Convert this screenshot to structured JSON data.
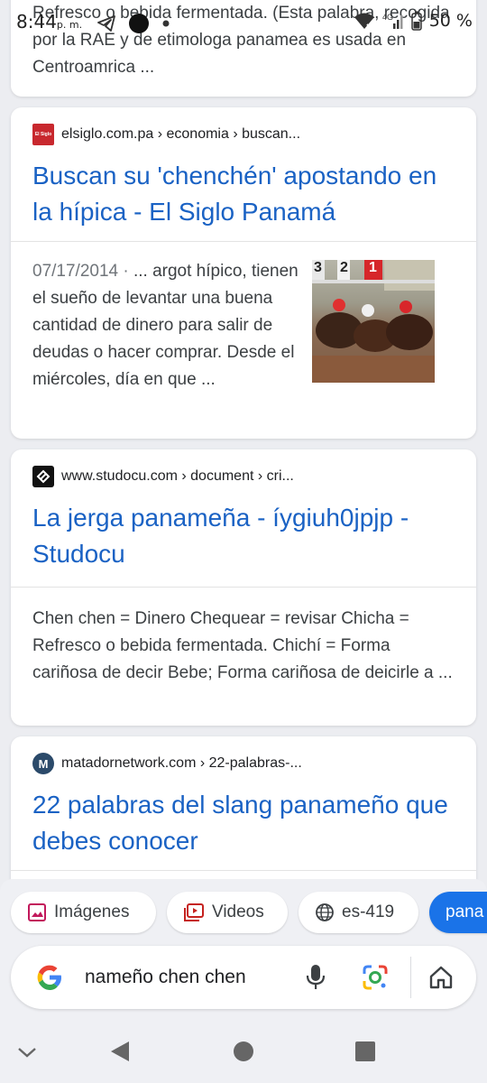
{
  "status_bar": {
    "time": "8:44",
    "ampm": "p. m.",
    "battery": "50 %"
  },
  "results": [
    {
      "snippet": "Refresco o bebida fermentada. (Esta palabra, recogida por la RAE y de etimologa panamea es usada en Centroamrica ..."
    },
    {
      "source": "elsiglo.com.pa › economia › buscan...",
      "favicon_text": "El Siglo",
      "title": "Buscan su 'chenchén' apostando en la hípica - El Siglo Panamá",
      "date": "07/17/2014 · ",
      "snippet": "... argot hípico, tienen el sueño de levantar una buena cantidad de dinero para salir de deudas o hacer comprar. Desde el miércoles, día en que ...",
      "thumbnail": "horse-race-photo",
      "thumbnail_numbers": [
        "3",
        "2",
        "1"
      ]
    },
    {
      "source": "www.studocu.com › document › cri...",
      "title": "La jerga panameña - íygiuh0jpjp - Studocu",
      "snippet": "Chen chen = Dinero Chequear = revisar Chicha = Refresco o bebida fermentada. Chichí = Forma cariñosa de decir Bebe; Forma cariñosa de deicirle a ..."
    },
    {
      "source": "matadornetwork.com › 22-palabras-...",
      "title": "22 palabras del slang panameño que debes conocer"
    }
  ],
  "chips": [
    {
      "label": "Imágenes",
      "icon": "image-icon"
    },
    {
      "label": "Videos",
      "icon": "video-icon"
    },
    {
      "label": "es-419",
      "icon": "globe-icon"
    },
    {
      "label": "pana"
    }
  ],
  "search": {
    "query": "nameño chen chen"
  },
  "colors": {
    "link": "#1a62c4",
    "accent": "#1a73e8",
    "background": "#ecedf1"
  }
}
